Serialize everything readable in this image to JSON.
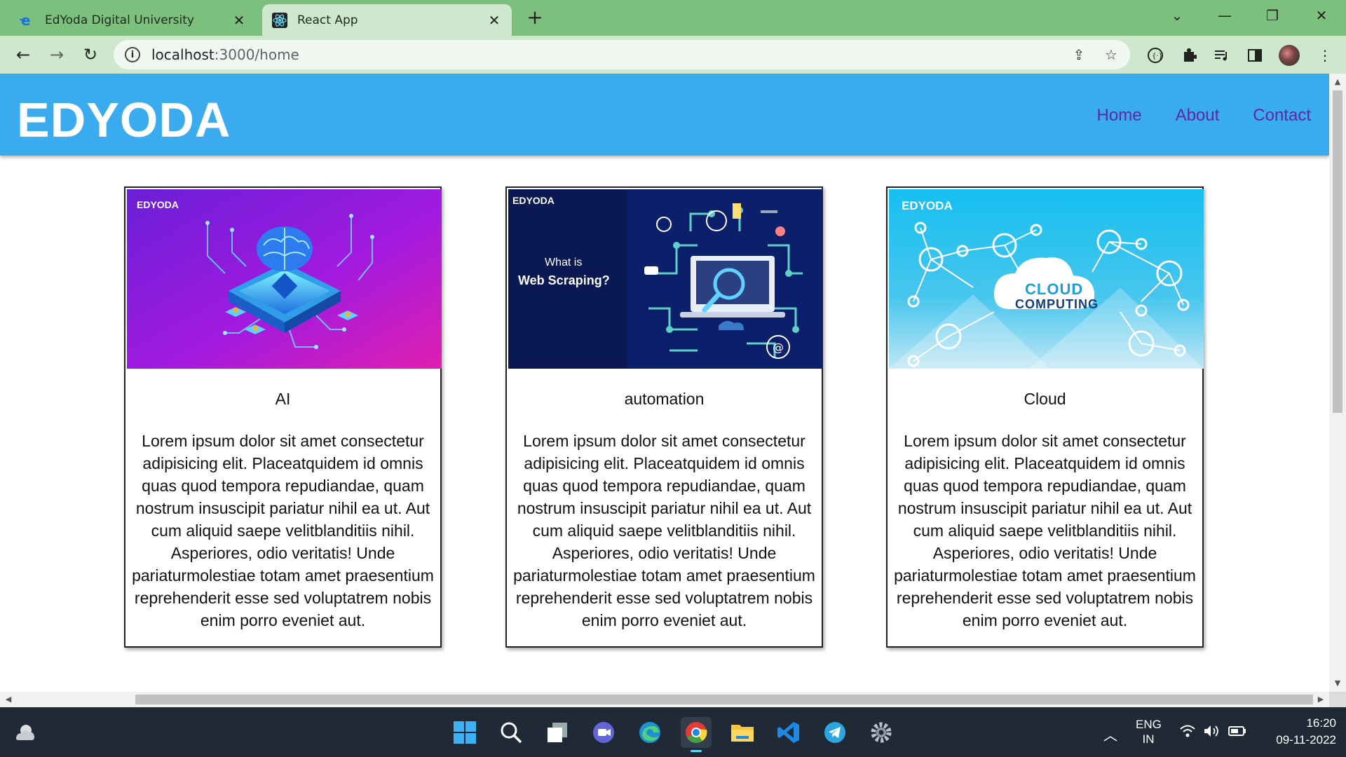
{
  "browser": {
    "tabs": [
      {
        "title": "EdYoda Digital University",
        "icon": "edyoda-favicon"
      },
      {
        "title": "React App",
        "icon": "react-favicon"
      }
    ],
    "new_tab_label": "+",
    "url_host": "localhost",
    "url_path": ":3000/home",
    "window_controls": {
      "minimize": "—",
      "restore": "❐",
      "close": "✕",
      "dropdown": "⌄"
    }
  },
  "site": {
    "logo": "EDYODA",
    "nav": [
      "Home",
      "About",
      "Contact"
    ]
  },
  "cards": [
    {
      "title": "AI",
      "image_tag": "EDYODA",
      "image_icon": "ai-brain-chip-illustration",
      "body": "Lorem ipsum dolor sit amet consectetur adipisicing elit. Placeatquidem id omnis quas quod tempora repudiandae, quam nostrum insuscipit pariatur nihil ea ut. Aut cum aliquid saepe velitblanditiis nihil. Asperiores, odio veritatis! Unde pariaturmolestiae totam amet praesentium reprehenderit esse sed voluptatrem nobis enim porro eveniet aut."
    },
    {
      "title": "automation",
      "image_tag": "EDYODA",
      "image_line1": "What is",
      "image_line2": "Web Scraping?",
      "image_icon": "web-scraping-laptop-illustration",
      "body": "Lorem ipsum dolor sit amet consectetur adipisicing elit. Placeatquidem id omnis quas quod tempora repudiandae, quam nostrum insuscipit pariatur nihil ea ut. Aut cum aliquid saepe velitblanditiis nihil. Asperiores, odio veritatis! Unde pariaturmolestiae totam amet praesentium reprehenderit esse sed voluptatrem nobis enim porro eveniet aut."
    },
    {
      "title": "Cloud",
      "image_tag": "EDYODA",
      "image_line1": "CLOUD",
      "image_line2": "COMPUTING",
      "image_icon": "cloud-network-illustration",
      "body": "Lorem ipsum dolor sit amet consectetur adipisicing elit. Placeatquidem id omnis quas quod tempora repudiandae, quam nostrum insuscipit pariatur nihil ea ut. Aut cum aliquid saepe velitblanditiis nihil. Asperiores, odio veritatis! Unde pariaturmolestiae totam amet praesentium reprehenderit esse sed voluptatrem nobis enim porro eveniet aut."
    }
  ],
  "taskbar": {
    "apps": [
      "start-icon",
      "search-icon",
      "task-view-icon",
      "teams-icon",
      "edge-icon",
      "chrome-icon",
      "file-explorer-icon",
      "vscode-icon",
      "telegram-icon",
      "settings-icon"
    ],
    "active_app": "chrome-icon",
    "lang_line1": "ENG",
    "lang_line2": "IN",
    "time": "16:20",
    "date": "09-11-2022"
  },
  "colors": {
    "tab_strip": "#7dbf7d",
    "toolbar": "#cde8cd",
    "site_header": "#3aabee",
    "nav_link": "#5a2a9e",
    "taskbar": "#202a36"
  }
}
